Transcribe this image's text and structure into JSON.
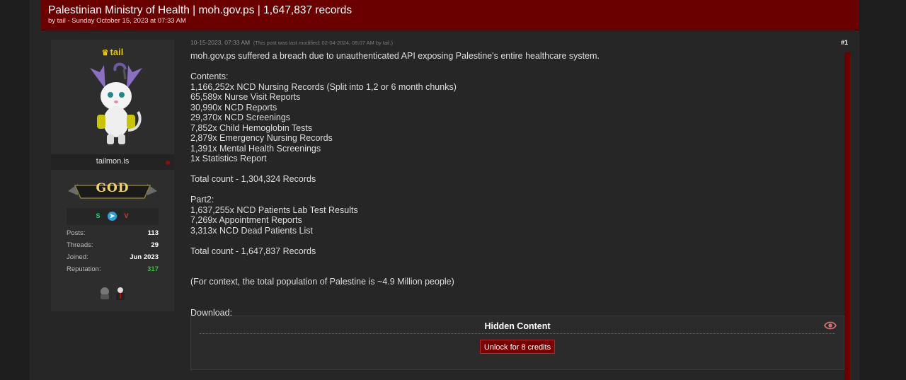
{
  "thread": {
    "title": "Palestinian Ministry of Health | moh.gov.ps | 1,647,837 records",
    "meta": "by tail - Sunday October 15, 2023 at 07:33 AM"
  },
  "user": {
    "name": "tail",
    "link_text": "tailmon.is",
    "rank": "GOD",
    "socials": [
      "session-icon",
      "telegram-icon",
      "tox-icon"
    ],
    "stats": [
      {
        "label": "Posts:",
        "value": "113"
      },
      {
        "label": "Threads:",
        "value": "29"
      },
      {
        "label": "Joined:",
        "value": "Jun 2023"
      },
      {
        "label": "Reputation:",
        "value": "317"
      }
    ],
    "colors": {
      "username": "#e6c800",
      "reputation": "#3dbb3d",
      "accent": "#6b0000"
    }
  },
  "post": {
    "timestamp": "10-15-2023, 07:33 AM",
    "modified": "(This post was last modified: 02-04-2024, 08:07 AM by tail.)",
    "number": "#1",
    "lines": [
      "moh.gov.ps suffered a breach due to unauthenticated API exposing Palestine's entire healthcare system.",
      "",
      "Contents:",
      "1,166,252x NCD Nursing Records (Split into 1,2 or 6 month chunks)",
      "65,589x Nurse Visit Reports",
      "30,990x NCD Reports",
      "29,370x NCD Screenings",
      "7,852x Child Hemoglobin Tests",
      "2,879x Emergency Nursing Records",
      "1,391x Mental Health Screenings",
      "1x Statistics Report",
      "",
      "Total count - 1,304,324 Records",
      "",
      "Part2:",
      "1,637,255x NCD Patients Lab Test Results",
      "7,269x Appointment Reports",
      "3,313x NCD Dead Patients List",
      "",
      "Total count - 1,647,837 Records",
      "",
      "",
      "(For context, the total population of Palestine is ~4.9 Million people)",
      "",
      "",
      "Download:"
    ]
  },
  "hidden_content": {
    "title": "Hidden Content",
    "button": "Unlock for 8 credits",
    "icon": "eye-icon"
  }
}
